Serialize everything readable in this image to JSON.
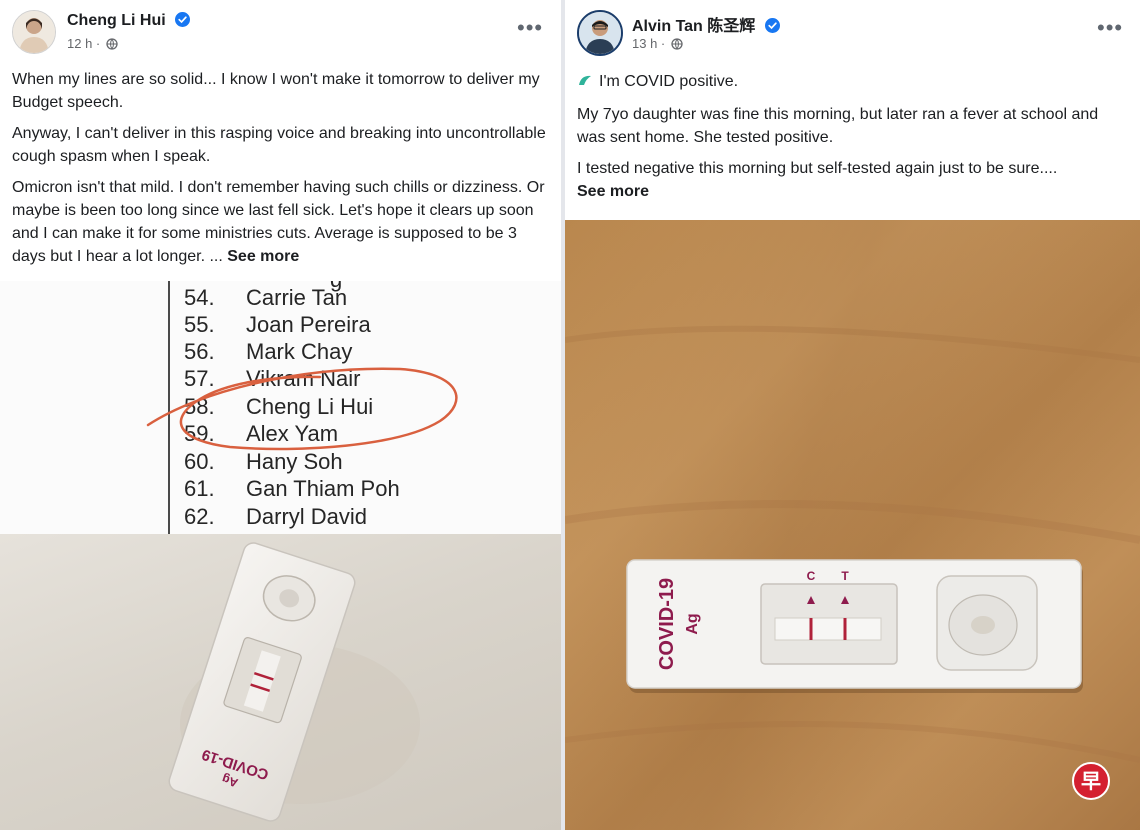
{
  "left_post": {
    "author": "Cheng Li Hui",
    "time": "12 h ·",
    "paragraphs": [
      "When my lines are so solid... I know I won't make it tomorrow to deliver my Budget speech.",
      "Anyway, I can't deliver in this rasping voice and breaking into uncontrollable cough spasm when I speak.",
      "Omicron isn't that mild. I don't remember having such chills or dizziness. Or maybe is been too long since we last fell sick. Let's hope it clears up soon and I can make it for some ministries cuts. Average is supposed to be 3 days but I hear a lot longer. ..."
    ],
    "see_more": "See more",
    "list": [
      {
        "num": "54.",
        "name": "Carrie Tan"
      },
      {
        "num": "55.",
        "name": "Joan Pereira"
      },
      {
        "num": "56.",
        "name": "Mark Chay"
      },
      {
        "num": "57.",
        "name": "Vikram Nair"
      },
      {
        "num": "58.",
        "name": "Cheng Li Hui"
      },
      {
        "num": "59.",
        "name": "Alex Yam"
      },
      {
        "num": "60.",
        "name": "Hany Soh"
      },
      {
        "num": "61.",
        "name": "Gan Thiam Poh"
      },
      {
        "num": "62.",
        "name": "Darryl David"
      }
    ],
    "test_label_1": "COVID-19",
    "test_label_2": "Ag"
  },
  "right_post": {
    "author": "Alvin Tan 陈圣辉",
    "time": "13 h ·",
    "paragraphs": [
      "I'm COVID positive.",
      "My 7yo daughter was fine this morning, but later ran a fever at school and was sent home. She tested positive.",
      "I tested negative this morning but self-tested again just to be sure...."
    ],
    "see_more": "See more",
    "test_label_1": "COVID-19",
    "test_label_2": "Ag",
    "c_label": "C",
    "t_label": "T"
  },
  "watermark": "早",
  "colors": {
    "verified": "#1877f2",
    "circle": "#d9603f",
    "test_red": "#b0223a"
  },
  "icons": {
    "verified": "verified-badge-icon",
    "globe": "globe-icon",
    "more": "more-options-icon"
  }
}
